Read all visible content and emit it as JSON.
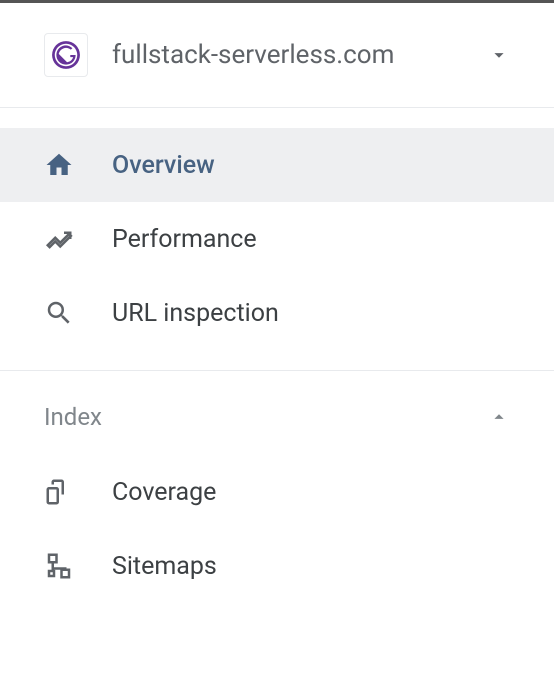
{
  "property": {
    "name": "fullstack-serverless.com",
    "icon": "gatsby-icon"
  },
  "nav": {
    "items": [
      {
        "label": "Overview",
        "icon": "home-icon",
        "selected": true
      },
      {
        "label": "Performance",
        "icon": "trending-icon",
        "selected": false
      },
      {
        "label": "URL inspection",
        "icon": "search-icon",
        "selected": false
      }
    ]
  },
  "sections": [
    {
      "title": "Index",
      "expanded": true,
      "items": [
        {
          "label": "Coverage",
          "icon": "coverage-icon"
        },
        {
          "label": "Sitemaps",
          "icon": "sitemap-icon"
        }
      ]
    }
  ]
}
